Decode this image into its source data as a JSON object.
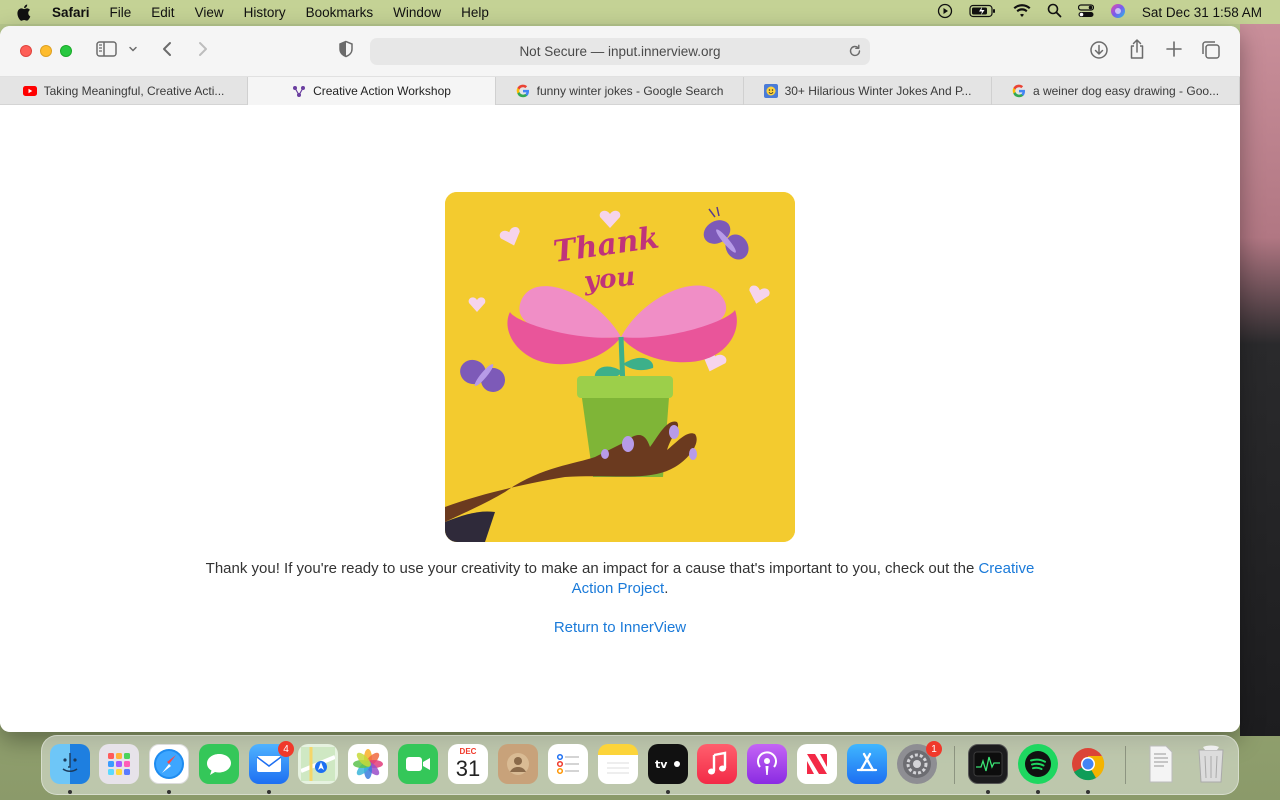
{
  "menubar": {
    "app_name": "Safari",
    "items": [
      "File",
      "Edit",
      "View",
      "History",
      "Bookmarks",
      "Window",
      "Help"
    ],
    "clock": "Sat Dec 31  1:58 AM"
  },
  "browser": {
    "url_text": "Not Secure — input.innerview.org",
    "tabs": [
      {
        "label": "Taking Meaningful, Creative Acti...",
        "favicon": "youtube-icon",
        "active": false
      },
      {
        "label": "Creative Action Workshop",
        "favicon": "innerview-icon",
        "active": true
      },
      {
        "label": "funny winter jokes - Google Search",
        "favicon": "google-icon",
        "active": false
      },
      {
        "label": "30+ Hilarious Winter Jokes And P...",
        "favicon": "emoji-site-icon",
        "active": false
      },
      {
        "label": "a weiner dog easy drawing - Goo...",
        "favicon": "google-icon",
        "active": false
      }
    ]
  },
  "page": {
    "image_text": "Thank you",
    "message_prefix": "Thank you! If you're ready to use your creativity to make an impact for a cause that's important to you, check out the ",
    "message_link": "Creative Action Project",
    "message_suffix": ".",
    "return_link": "Return to InnerView"
  },
  "dock": {
    "mail_badge": "4",
    "calendar_month": "DEC",
    "calendar_day": "31",
    "settings_badge": "1",
    "apps": [
      "Finder",
      "Launchpad",
      "Safari",
      "Messages",
      "Mail",
      "Maps",
      "Photos",
      "FaceTime",
      "Calendar",
      "Contacts",
      "Reminders",
      "Notes",
      "TV",
      "Music",
      "Podcasts",
      "News",
      "App Store",
      "System Settings",
      "Activity Monitor",
      "Spotify",
      "Chrome",
      "Document",
      "Trash"
    ]
  },
  "colors": {
    "link": "#1a7ad9",
    "card_background": "#f3cb2f",
    "petal_pink": "#f08ec6",
    "pot_green": "#8dc63f"
  }
}
